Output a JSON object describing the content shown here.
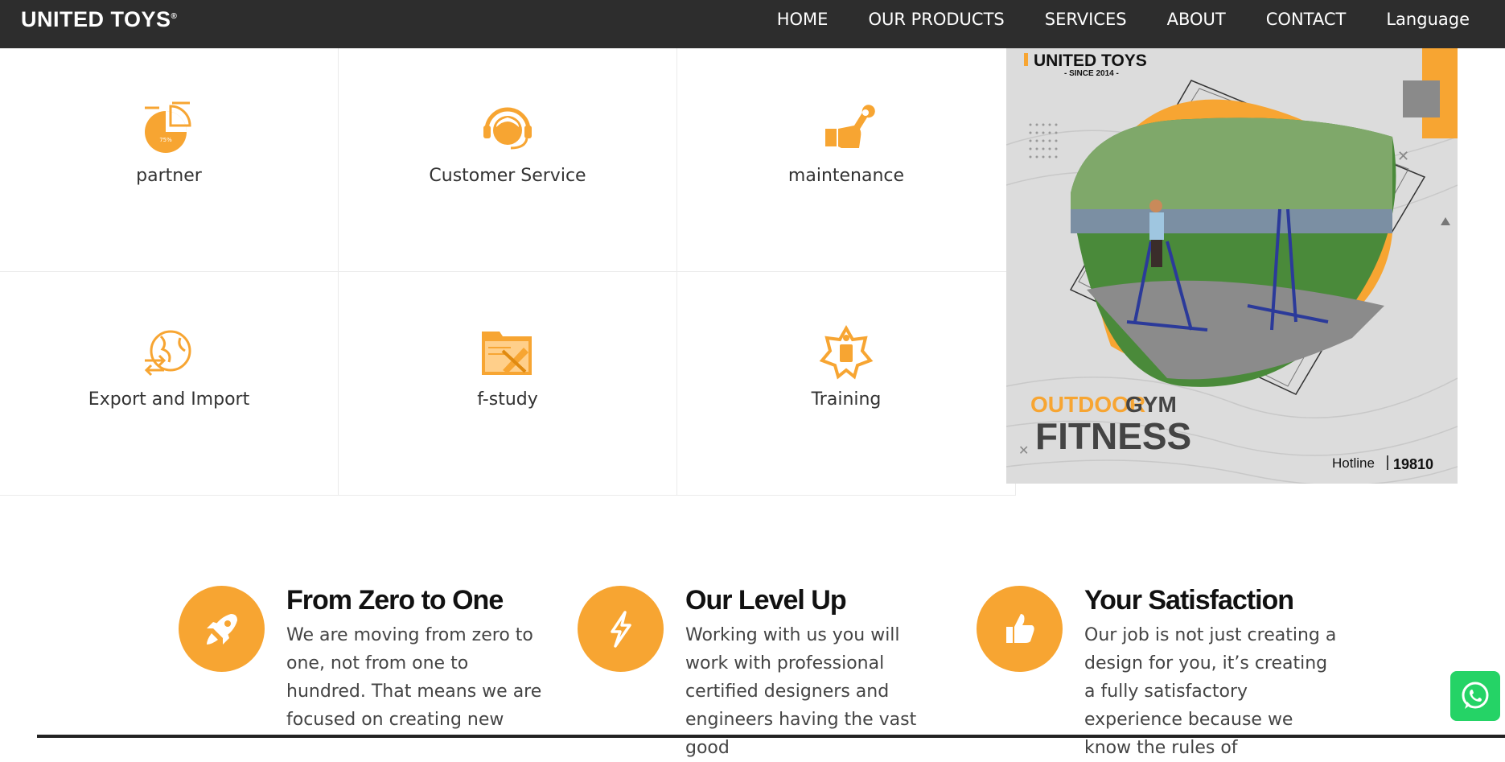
{
  "header": {
    "logo": "UNITED TOYS",
    "nav": [
      "HOME",
      "OUR PRODUCTS",
      "SERVICES",
      "ABOUT",
      "CONTACT",
      "Language"
    ]
  },
  "services": [
    {
      "label": "partner",
      "icon": "pie-chart-icon"
    },
    {
      "label": "Customer Service",
      "icon": "headset-icon"
    },
    {
      "label": "maintenance",
      "icon": "wrench-hand-icon"
    },
    {
      "label": "Export and Import",
      "icon": "globe-arrows-icon"
    },
    {
      "label": "f-study",
      "icon": "folder-ruler-icon"
    },
    {
      "label": "Training",
      "icon": "training-star-icon"
    }
  ],
  "promo": {
    "brand": "UNITED TOYS",
    "since": "- SINCE 2014 -",
    "line1a": "OUTDOOR",
    "line1b": "GYM",
    "line2": "FITNESS",
    "hotline_label": "Hotline",
    "hotline_number": "19810",
    "pie_label": "75%"
  },
  "features": [
    {
      "title": "From Zero to One",
      "body": "We are moving from zero to one, not from one to hundred. That means we are focused on creating new",
      "icon": "rocket-icon"
    },
    {
      "title": "Our Level Up",
      "body": "Working with us you will work with professional certified designers and engineers having the vast good",
      "icon": "lightning-icon"
    },
    {
      "title": "Your Satisfaction",
      "body": "Our job is not just creating a design for you, it’s creating a fully satisfactory experience because we know the rules of",
      "icon": "thumbs-up-icon"
    }
  ],
  "colors": {
    "accent": "#f7a532",
    "header_bg": "#2d2d2d",
    "whatsapp": "#25d366"
  }
}
